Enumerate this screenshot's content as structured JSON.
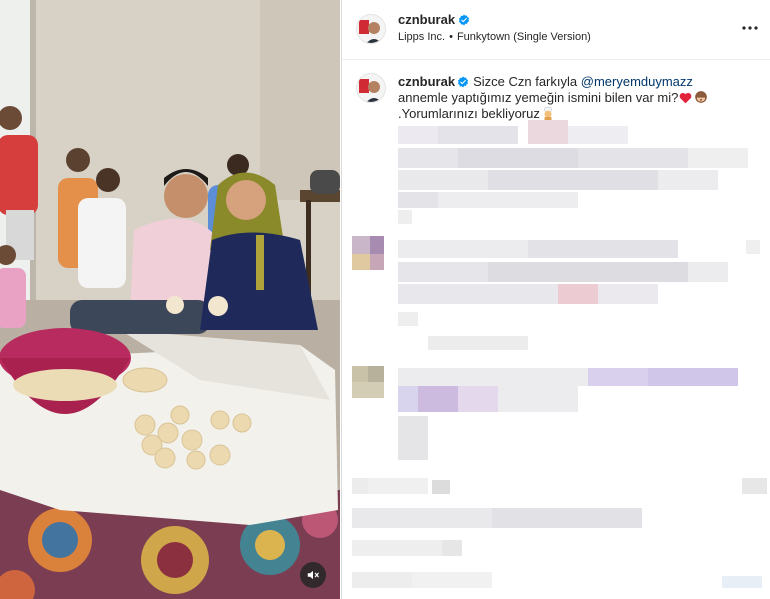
{
  "post": {
    "username": "cznburak",
    "verified": true,
    "audio": {
      "artist": "Lipps Inc.",
      "separator": "•",
      "track": "Funkytown (Single Version)"
    }
  },
  "caption": {
    "username": "cznburak",
    "text_before_mention": "Sizce Czn farkıyla",
    "mention": "@meryemduymazz",
    "text_after_mention": "annemle yaptığımız yemeğin ismini bilen var mi?",
    "text_end": ".Yorumlarınızı bekliyoruz"
  },
  "colors": {
    "link": "#00376b",
    "verified_badge": "#0095f6",
    "divider": "#dbdbdb"
  },
  "icons": {
    "more": "more-horizontal-icon",
    "mute": "speaker-muted-icon",
    "verified": "verified-badge-icon"
  }
}
